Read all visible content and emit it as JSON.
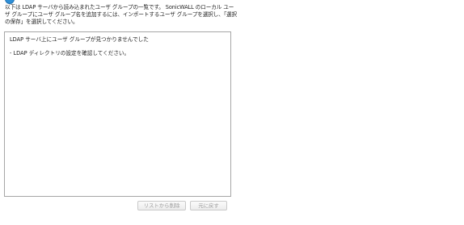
{
  "header": {
    "icon": "info-icon",
    "description": "以下は LDAP サーバから読み込まれたユーザ グループの一覧です。 SonicWALL のローカル ユーザ グループにユーザ グループ名を追加するには、インポートするユーザ グループを選択し、「選択の保存」を選択してください。"
  },
  "result": {
    "message": "LDAP サーバ上にユーザ グループが見つかりませんでした",
    "hint": "- LDAP ディレクトリの設定を確認してください。"
  },
  "buttons": {
    "remove_label": "リストから削除",
    "restore_label": "元に戻す"
  }
}
